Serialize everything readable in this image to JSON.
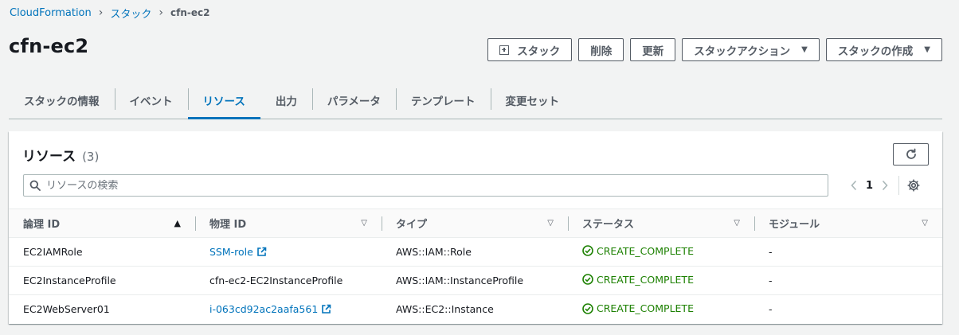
{
  "breadcrumb": {
    "items": [
      "CloudFormation",
      "スタック"
    ],
    "current": "cfn-ec2"
  },
  "page": {
    "title": "cfn-ec2"
  },
  "header_actions": {
    "stack_label": "スタック",
    "delete_label": "削除",
    "update_label": "更新",
    "stack_actions_label": "スタックアクション",
    "create_stack_label": "スタックの作成"
  },
  "tabs": [
    {
      "label": "スタックの情報",
      "active": false
    },
    {
      "label": "イベント",
      "active": false
    },
    {
      "label": "リソース",
      "active": true
    },
    {
      "label": "出力",
      "active": false
    },
    {
      "label": "パラメータ",
      "active": false
    },
    {
      "label": "テンプレート",
      "active": false
    },
    {
      "label": "変更セット",
      "active": false
    }
  ],
  "resources": {
    "title": "リソース",
    "count": "(3)",
    "search_placeholder": "リソースの検索",
    "page_number": "1",
    "columns": [
      "論理 ID",
      "物理 ID",
      "タイプ",
      "ステータス",
      "モジュール"
    ],
    "rows": [
      {
        "logical_id": "EC2IAMRole",
        "physical_id": "SSM-role",
        "physical_link": true,
        "type": "AWS::IAM::Role",
        "status": "CREATE_COMPLETE",
        "module": "-"
      },
      {
        "logical_id": "EC2InstanceProfile",
        "physical_id": "cfn-ec2-EC2InstanceProfile",
        "physical_link": false,
        "type": "AWS::IAM::InstanceProfile",
        "status": "CREATE_COMPLETE",
        "module": "-"
      },
      {
        "logical_id": "EC2WebServer01",
        "physical_id": "i-063cd92ac2aafa561",
        "physical_link": true,
        "type": "AWS::EC2::Instance",
        "status": "CREATE_COMPLETE",
        "module": "-"
      }
    ]
  },
  "colors": {
    "link": "#0073bb",
    "success": "#1d8102",
    "text": "#16191f",
    "secondary": "#545b64"
  }
}
